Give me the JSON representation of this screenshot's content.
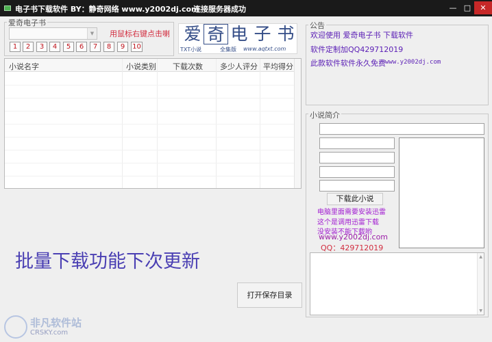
{
  "window": {
    "title": "电子书下载软件  BY：静奇网络 www.y2002dj.com",
    "status": "连接服务器成功",
    "min_glyph": "—",
    "max_glyph": "□",
    "close_glyph": "✕"
  },
  "library": {
    "legend": "爱奇电子书",
    "combo_value": "",
    "hint": "用鼠标右键点击喇",
    "pages": [
      "1",
      "2",
      "3",
      "4",
      "5",
      "6",
      "7",
      "8",
      "9",
      "10"
    ]
  },
  "logo": {
    "chars": [
      "爱",
      "奇",
      "电",
      "子",
      "书"
    ],
    "sub1": "TXT小说",
    "sub2": "全集版",
    "url": "www.aqtxt.com"
  },
  "table": {
    "columns": [
      "小说名字",
      "小说类别",
      "下载次数",
      "多少人评分",
      "平均得分"
    ],
    "rows": []
  },
  "batch_notice": "批量下载功能下次更新",
  "open_dir_button": "打开保存目录",
  "notice": {
    "legend": "公告",
    "line1": "欢迎使用  爱奇电子书 下载软件",
    "line2": "软件定制加QQ429712019",
    "line3_cn": "此款软件软件永久免费",
    "line3_url": "www.y2002dj.com"
  },
  "intro": {
    "legend": "小说简介",
    "download_button": "下载此小说",
    "info1": "电脑里面需要安装迅雷",
    "info2": "这个是调用迅雷下载",
    "info3": "没安装不能下载哟",
    "site": "www.y2002dj.com",
    "qq": "QQ：429712019"
  },
  "watermark": {
    "name_cn": "非凡软件站",
    "name_en": "CRSKY.com"
  },
  "colors": {
    "titlebar": "#1a1a1a",
    "close": "#c62828",
    "hint_red": "#d22d3f",
    "batch_blue": "#4a3fb3",
    "notice_purple": "#5a1db5",
    "info_magenta": "#a21ed1"
  }
}
